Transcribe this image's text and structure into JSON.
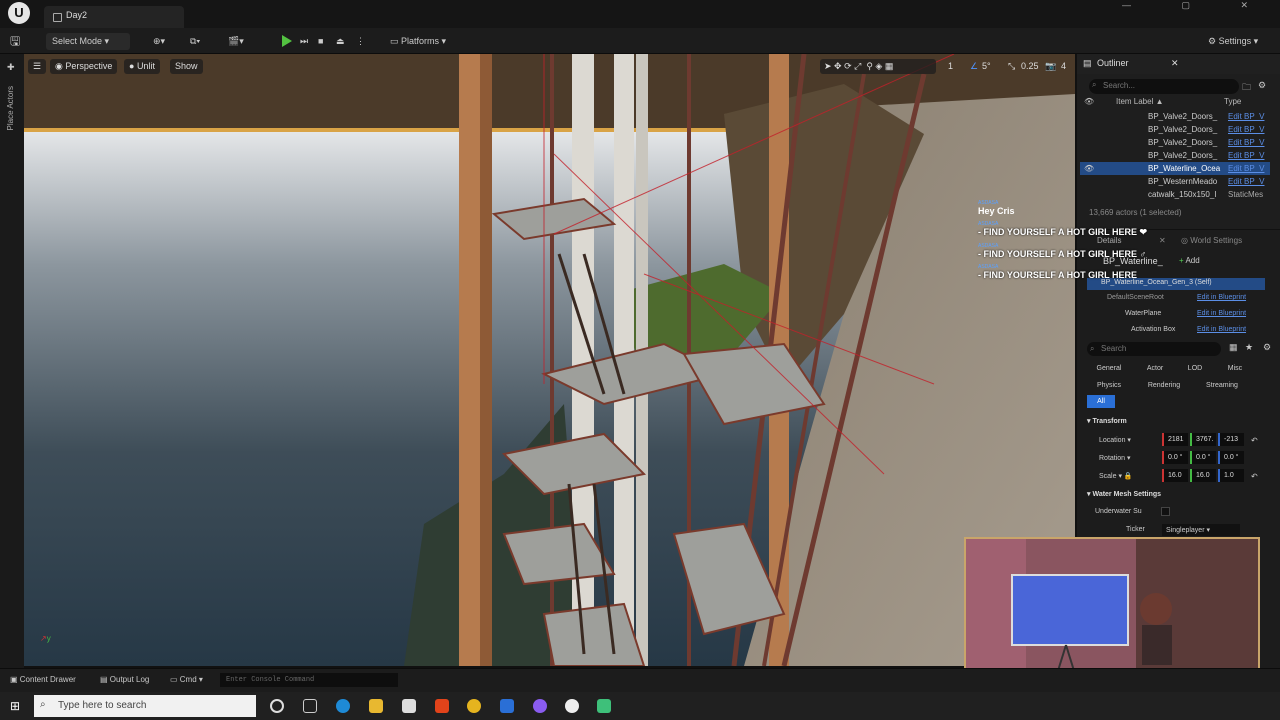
{
  "window": {
    "tab_title": "Day2"
  },
  "toolbar": {
    "select_mode": "Select Mode",
    "platforms": "Platforms",
    "settings": "Settings"
  },
  "left_sidebar": {
    "place_actors": "Place Actors"
  },
  "viewport": {
    "perspective": "Perspective",
    "unlit": "Unlit",
    "show": "Show",
    "grid_value": "1",
    "angle_value": "5°",
    "scale_value": "0.25",
    "camera_speed": "4"
  },
  "chat": {
    "name": "Hey Cris",
    "user": "ASDASA",
    "messages": [
      "- FIND YOURSELF A HOT GIRL HERE ❤",
      "- FIND YOURSELF A HOT GIRL HERE ♂",
      "- FIND YOURSELF A HOT GIRL HERE"
    ]
  },
  "outliner": {
    "title": "Outliner",
    "search_placeholder": "Search...",
    "col_label": "Item Label ▲",
    "col_type": "Type",
    "rows": [
      {
        "name": "BP_Valve2_Doors_",
        "type": "Edit BP_V"
      },
      {
        "name": "BP_Valve2_Doors_",
        "type": "Edit BP_V"
      },
      {
        "name": "BP_Valve2_Doors_",
        "type": "Edit BP_V"
      },
      {
        "name": "BP_Valve2_Doors_",
        "type": "Edit BP_V"
      },
      {
        "name": "BP_Waterline_Ocea",
        "type": "Edit BP_V"
      },
      {
        "name": "BP_WesternMeado",
        "type": "Edit BP_V"
      },
      {
        "name": "catwalk_150x150_I",
        "type": "StaticMes"
      }
    ],
    "status": "13,669 actors (1 selected)"
  },
  "details": {
    "tab": "Details",
    "world_settings": "World Settings",
    "actor_name": "BP_Waterline_",
    "add": "Add",
    "self_row": "BP_Waterline_Ocean_Gen_3 (Self)",
    "components": [
      {
        "name": "DefaultSceneRoot",
        "link": "Edit in Blueprint"
      },
      {
        "name": "WaterPlane",
        "link": "Edit in Blueprint"
      },
      {
        "name": "Activation Box",
        "link": "Edit in Blueprint"
      }
    ],
    "search_placeholder": "Search",
    "filters": [
      "General",
      "Actor",
      "LOD",
      "Misc",
      "Physics",
      "Rendering",
      "Streaming",
      "All"
    ],
    "transform": "Transform",
    "location": "Location",
    "rotation": "Rotation",
    "scale": "Scale",
    "loc_vals": [
      "2181",
      "3767.",
      "-213"
    ],
    "rot_vals": [
      "0.0 °",
      "0.0 °",
      "0.0 °"
    ],
    "scale_vals": [
      "16.0",
      "16.0",
      "1.0"
    ],
    "water_mesh": "Water Mesh Settings",
    "underwater": "Underwater Su",
    "ticker": "Ticker",
    "ticker_val": "Singleplayer"
  },
  "bottom": {
    "content_drawer": "Content Drawer",
    "output_log": "Output Log",
    "cmd": "Cmd",
    "console_placeholder": "Enter Console Command"
  },
  "taskbar": {
    "search": "Type here to search"
  }
}
